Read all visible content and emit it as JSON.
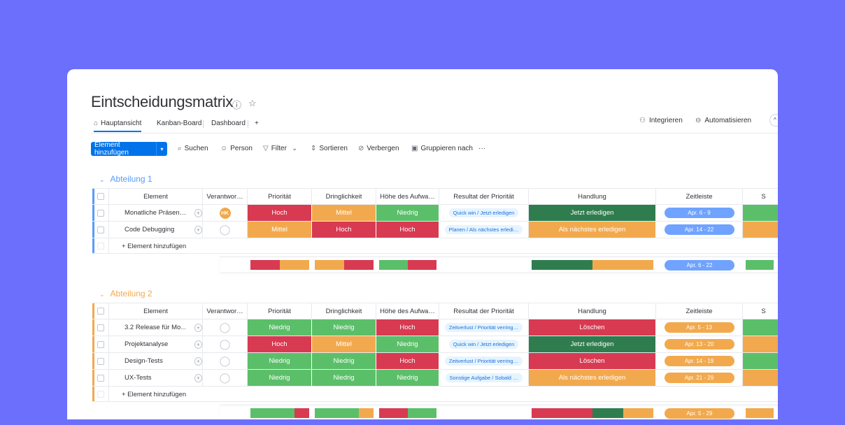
{
  "board": {
    "title": "Eintscheidungsmatrix",
    "tabs": [
      "Hauptansicht",
      "Kanban-Board",
      "Dashboard",
      "+"
    ],
    "integrate_label": "Integrieren",
    "automate_label": "Automatisieren"
  },
  "toolbar": {
    "add_button": "Element hinzufügen",
    "search": "Suchen",
    "person": "Person",
    "filter": "Filter",
    "sort": "Sortieren",
    "hide": "Verbergen",
    "group": "Gruppieren nach",
    "more": "···"
  },
  "colors": {
    "red": "#d83a52",
    "orange": "#f2a94d",
    "green": "#5bbf6a",
    "dark_green": "#2f7d4f",
    "blue_pill": "#6fa3ff",
    "group1": "#579bfc",
    "group2": "#f2a94d"
  },
  "columns": [
    "Element",
    "Verantwor…",
    "Priorität",
    "Dringlichkeit",
    "Höhe des Aufwa…",
    "Resultat der Priorität",
    "Handlung",
    "Zeitleiste",
    "S"
  ],
  "add_item_label": "+ Element hinzufügen",
  "groups": [
    {
      "title": "Abteilung 1",
      "rows": [
        {
          "name": "Monatliche Präsen…",
          "owner": "HK",
          "priority": "Hoch",
          "urgency": "Mittel",
          "effort": "Niedrig",
          "result": "Quick win / Jetzt erledigen",
          "action": "Jetzt erledigen",
          "timeline": "Apr. 6 - 9"
        },
        {
          "name": "Code Debugging",
          "owner": "",
          "priority": "Mittel",
          "urgency": "Hoch",
          "effort": "Hoch",
          "result": "Planen / Als nächstes erledi…",
          "action": "Als nächstes erledigen",
          "timeline": "Apr. 14 - 22"
        }
      ],
      "summary_timeline": "Apr. 6 - 22"
    },
    {
      "title": "Abteilung 2",
      "rows": [
        {
          "name": "3.2 Release für Mo…",
          "owner": "",
          "priority": "Niedrig",
          "urgency": "Niedrig",
          "effort": "Hoch",
          "result": "Zeitverlust / Priorität verring…",
          "action": "Löschen",
          "timeline": "Apr. 5 - 13"
        },
        {
          "name": "Projektanalyse",
          "owner": "",
          "priority": "Hoch",
          "urgency": "Mittel",
          "effort": "Niedrig",
          "result": "Quick win / Jetzt erledigen",
          "action": "Jetzt erledigen",
          "timeline": "Apr. 13 - 20"
        },
        {
          "name": "Design-Tests",
          "owner": "",
          "priority": "Niedrig",
          "urgency": "Niedrig",
          "effort": "Hoch",
          "result": "Zeitverlust / Priorität verring…",
          "action": "Löschen",
          "timeline": "Apr. 14 - 19"
        },
        {
          "name": "UX-Tests",
          "owner": "",
          "priority": "Niedrig",
          "urgency": "Niedrig",
          "effort": "Niedrig",
          "result": "Sonstige Aufgabe / Sobald …",
          "action": "Als nächstes erledigen",
          "timeline": "Apr. 21 - 29"
        }
      ],
      "summary_timeline": "Apr. 5 - 29"
    }
  ]
}
